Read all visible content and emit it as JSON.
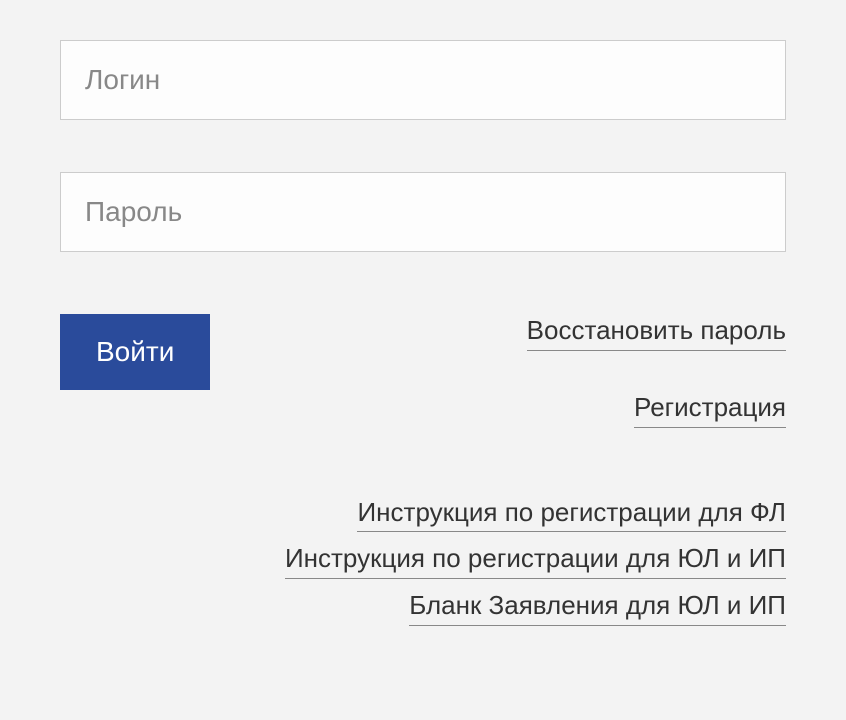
{
  "form": {
    "login_placeholder": "Логин",
    "password_placeholder": "Пароль",
    "submit_label": "Войти"
  },
  "links": {
    "recover_password": "Восстановить пароль",
    "registration": "Регистрация",
    "instruction_fl": "Инструкция по регистрации для ФЛ",
    "instruction_ul_ip": "Инструкция по регистрации для ЮЛ и ИП",
    "application_form_ul_ip": "Бланк Заявления для ЮЛ и ИП"
  }
}
